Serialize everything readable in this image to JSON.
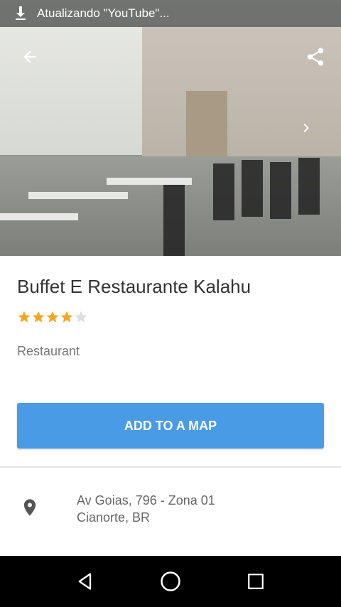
{
  "status_bar": {
    "download_icon": "download-icon",
    "text": "Atualizando \"YouTube\"..."
  },
  "toolbar": {
    "back_icon": "arrow-back-icon",
    "share_icon": "share-icon",
    "next_photo_icon": "chevron-right-icon"
  },
  "place": {
    "name": "Buffet E Restaurante Kalahu",
    "rating": 4,
    "rating_max": 5,
    "category": "Restaurant"
  },
  "actions": {
    "add_to_map_label": "ADD TO A MAP"
  },
  "address": {
    "line1": "Av Goias, 796 - Zona 01",
    "line2": "Cianorte, BR",
    "icon": "location-pin-icon"
  },
  "colors": {
    "accent": "#4a9be6",
    "star_filled": "#f5a623",
    "star_empty": "#dddddd",
    "pin": "#555555"
  },
  "nav_bar": {
    "back": "nav-back-icon",
    "home": "nav-home-icon",
    "recents": "nav-recents-icon"
  }
}
